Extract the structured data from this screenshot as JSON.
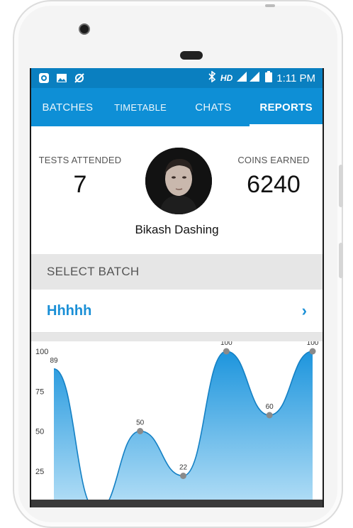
{
  "status_bar": {
    "network": "HD",
    "time": "1:11 PM"
  },
  "tabs": [
    {
      "label": "BATCHES"
    },
    {
      "label": "TIMETABLE"
    },
    {
      "label": "CHATS"
    },
    {
      "label": "REPORTS"
    }
  ],
  "profile": {
    "tests_label": "TESTS ATTENDED",
    "tests_value": "7",
    "coins_label": "COINS EARNED",
    "coins_value": "6240",
    "name": "Bikash Dashing"
  },
  "select_batch": {
    "header": "SELECT BATCH",
    "value": "Hhhhh"
  },
  "colors": {
    "primary": "#0e8fd6",
    "status_bar": "#0a7fc0",
    "accent_text": "#1a8fd6",
    "area_fill": "#2a9ee0"
  },
  "chart_data": {
    "type": "area",
    "x": [
      1,
      2,
      3,
      4,
      5,
      6,
      7
    ],
    "values": [
      89,
      0,
      50,
      22,
      100,
      60,
      100
    ],
    "point_labels": [
      "89",
      "",
      "50",
      "22",
      "100",
      "60",
      "100"
    ],
    "y_ticks": [
      "100",
      "75",
      "50",
      "25"
    ],
    "ylim": [
      0,
      100
    ],
    "grid": false
  }
}
